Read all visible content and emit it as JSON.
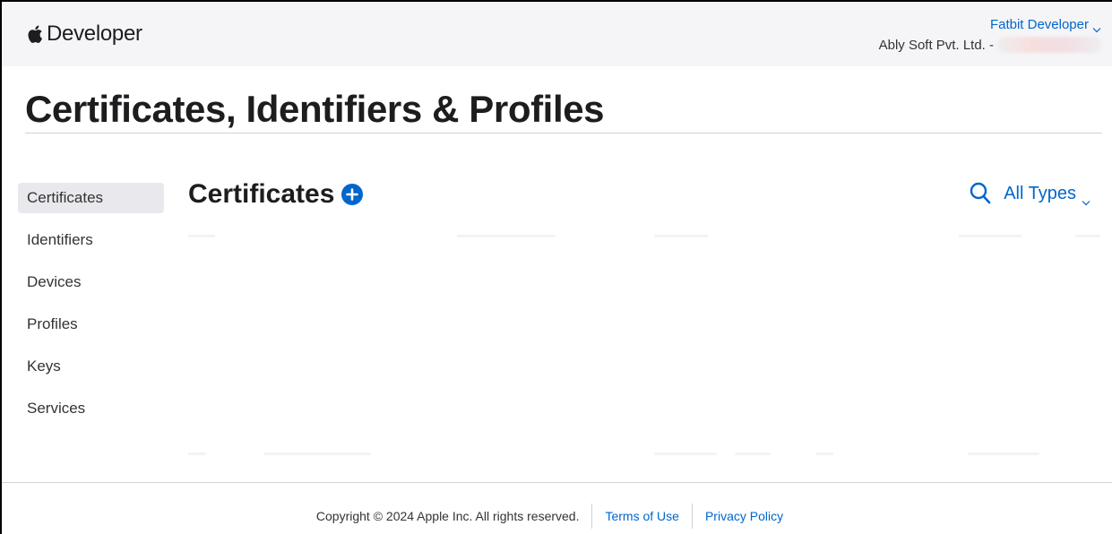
{
  "header": {
    "brand": "Developer",
    "account_name": "Fatbit Developer",
    "team_name": "Ably Soft Pvt. Ltd. -"
  },
  "page": {
    "title": "Certificates, Identifiers & Profiles"
  },
  "sidebar": {
    "items": [
      {
        "label": "Certificates",
        "active": true
      },
      {
        "label": "Identifiers"
      },
      {
        "label": "Devices"
      },
      {
        "label": "Profiles"
      },
      {
        "label": "Keys"
      },
      {
        "label": "Services"
      }
    ]
  },
  "main": {
    "section_title": "Certificates",
    "filter_label": "All Types"
  },
  "footer": {
    "copyright": "Copyright © 2024 Apple Inc. All rights reserved.",
    "terms": "Terms of Use",
    "privacy": "Privacy Policy"
  },
  "colors": {
    "accent": "#0066cc",
    "nav_bg": "#f5f5f7",
    "active_bg": "#e8e8ed"
  },
  "icons": {
    "brand": "apple-logo-icon",
    "add": "add-circle-icon",
    "search": "search-icon",
    "dropdown": "chevron-down-icon"
  }
}
